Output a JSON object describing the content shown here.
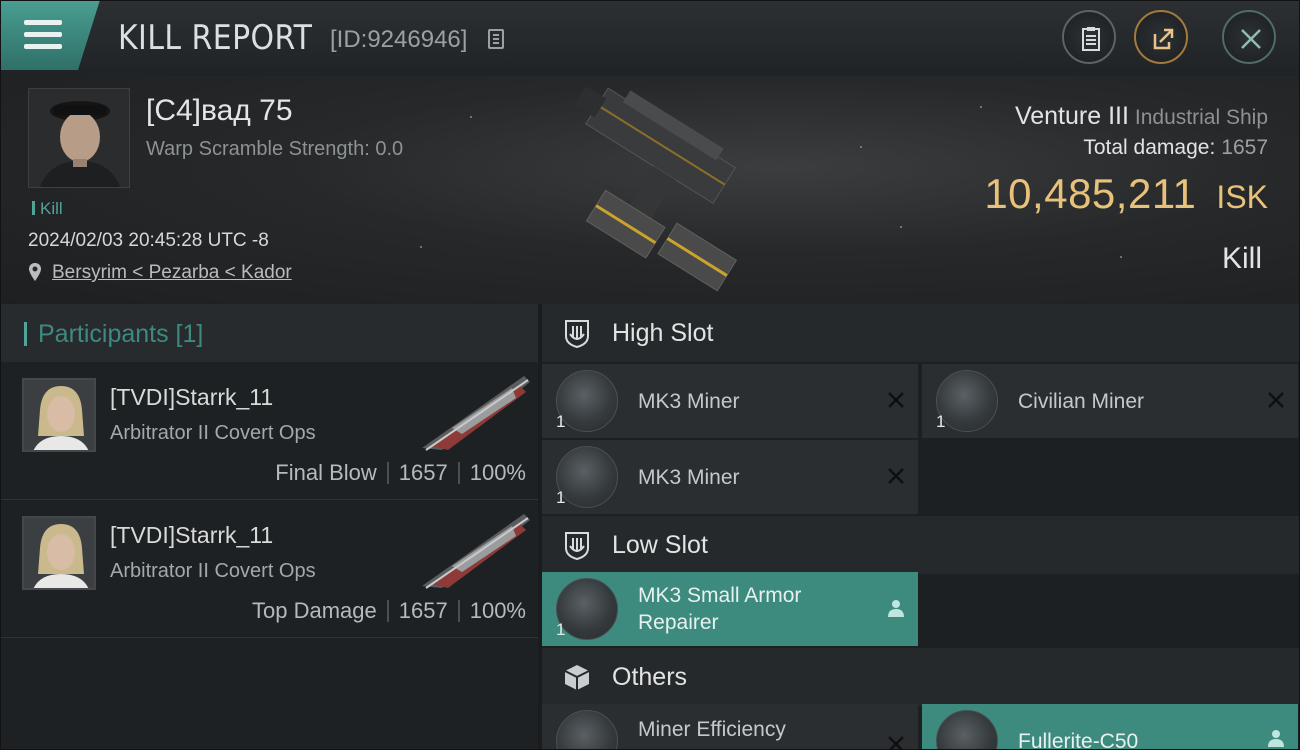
{
  "header": {
    "title": "KILL REPORT",
    "report_id": "[ID:9246946]"
  },
  "victim": {
    "name": "[C4]вад 75",
    "warp_scramble": "Warp Scramble Strength: 0.0",
    "tag": "Kill",
    "timestamp": "2024/02/03 20:45:28 UTC -8",
    "location": "Bersyrim < Pezarba < Kador",
    "ship_name": "Venture III",
    "ship_class": "Industrial Ship",
    "damage_label": "Total damage:",
    "damage_value": "1657",
    "isk_value": "10,485,211",
    "isk_unit": "ISK",
    "result": "Kill"
  },
  "participants": {
    "title": "Participants [1]",
    "items": [
      {
        "name": "[TVDI]Starrk_11",
        "ship": "Arbitrator II Covert Ops",
        "role": "Final Blow",
        "damage": "1657",
        "percent": "100%"
      },
      {
        "name": "[TVDI]Starrk_11",
        "ship": "Arbitrator II Covert Ops",
        "role": "Top Damage",
        "damage": "1657",
        "percent": "100%"
      }
    ]
  },
  "fitting": {
    "high_slot": {
      "label": "High Slot",
      "modules": [
        {
          "name": "MK3 Miner",
          "qty": "1",
          "status": "destroyed"
        },
        {
          "name": "Civilian Miner",
          "qty": "1",
          "status": "destroyed"
        },
        {
          "name": "MK3 Miner",
          "qty": "1",
          "status": "destroyed"
        }
      ]
    },
    "low_slot": {
      "label": "Low Slot",
      "modules": [
        {
          "name": "MK3 Small Armor Repairer",
          "name_line1": "MK3 Small Armor",
          "name_line2": "Repairer",
          "qty": "1",
          "status": "dropped"
        }
      ]
    },
    "others": {
      "label": "Others",
      "modules": [
        {
          "name": "Miner Efficiency",
          "qty": "",
          "status": "destroyed"
        },
        {
          "name": "Fullerite-C50",
          "qty": "",
          "status": "dropped"
        }
      ]
    }
  },
  "colors": {
    "accent": "#4fa597",
    "isk": "#e8c27a",
    "fitted_bg": "#3d8a7e"
  },
  "icons": [
    "menu-icon",
    "copy-icon",
    "clipboard-icon",
    "share-icon",
    "close-icon",
    "location-pin-icon",
    "high-slot-icon",
    "low-slot-icon",
    "others-icon",
    "destroyed-icon",
    "dropped-icon"
  ]
}
